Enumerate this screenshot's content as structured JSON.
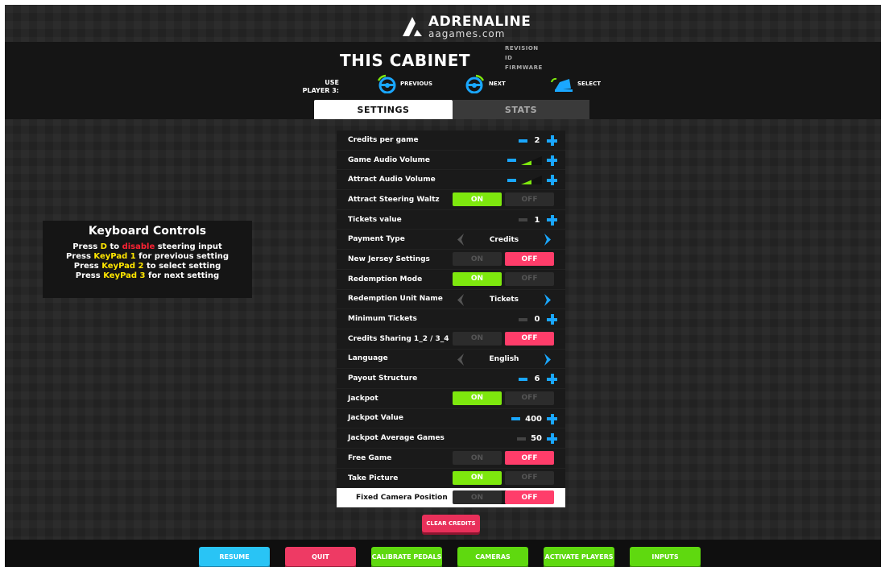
{
  "brand": {
    "name": "ADRENALINE",
    "site": "aagames.com"
  },
  "header": {
    "title": "THIS CABINET",
    "meta": [
      "REVISION",
      "ID",
      "FIRMWARE"
    ],
    "use_label_1": "USE",
    "use_label_2": "PLAYER 3:",
    "nav": [
      {
        "label": "PREVIOUS",
        "icon": "steering-wheel-left-icon"
      },
      {
        "label": "NEXT",
        "icon": "steering-wheel-right-icon"
      },
      {
        "label": "SELECT",
        "icon": "pedal-icon"
      }
    ]
  },
  "tabs": {
    "settings": "SETTINGS",
    "stats": "STATS",
    "active": "settings"
  },
  "keyboard": {
    "heading": "Keyboard Controls",
    "line1": {
      "a": "Press ",
      "b": "D",
      "c": " to ",
      "d": "disable",
      "e": " steering input"
    },
    "line2": {
      "a": "Press ",
      "b": "KeyPad 1",
      "c": " for previous setting"
    },
    "line3": {
      "a": "Press ",
      "b": "KeyPad 2",
      "c": " to select setting"
    },
    "line4": {
      "a": "Press ",
      "b": "KeyPad 3",
      "c": " for next setting"
    }
  },
  "toggle_labels": {
    "on": "ON",
    "off": "OFF"
  },
  "settings": [
    {
      "label": "Credits per game",
      "type": "number",
      "value": "2",
      "minus_enabled": true
    },
    {
      "label": "Game Audio Volume",
      "type": "volume",
      "level": 0.5
    },
    {
      "label": "Attract Audio Volume",
      "type": "volume",
      "level": 0.5
    },
    {
      "label": "Attract Steering Waltz",
      "type": "toggle",
      "state": "on"
    },
    {
      "label": "Tickets value",
      "type": "number",
      "value": "1",
      "minus_enabled": false
    },
    {
      "label": "Payment Type",
      "type": "select",
      "value": "Credits"
    },
    {
      "label": "New Jersey Settings",
      "type": "toggle",
      "state": "off"
    },
    {
      "label": "Redemption Mode",
      "type": "toggle",
      "state": "on"
    },
    {
      "label": "Redemption Unit Name",
      "type": "select",
      "value": "Tickets"
    },
    {
      "label": "Minimum Tickets",
      "type": "number",
      "value": "0",
      "minus_enabled": false
    },
    {
      "label": "Credits Sharing 1_2 / 3_4",
      "type": "toggle",
      "state": "off"
    },
    {
      "label": "Language",
      "type": "select",
      "value": "English"
    },
    {
      "label": "Payout Structure",
      "type": "number",
      "value": "6",
      "minus_enabled": true
    },
    {
      "label": "Jackpot",
      "type": "toggle",
      "state": "on"
    },
    {
      "label": "Jackpot Value",
      "type": "number",
      "value": "400",
      "minus_enabled": true
    },
    {
      "label": "Jackpot Average Games",
      "type": "number",
      "value": "50",
      "minus_enabled": false
    },
    {
      "label": "Free Game",
      "type": "toggle",
      "state": "off"
    },
    {
      "label": "Take Picture",
      "type": "toggle",
      "state": "on"
    },
    {
      "label": "Fixed Camera Position",
      "type": "toggle",
      "state": "off",
      "highlighted": true
    }
  ],
  "clear_credits": "CLEAR CREDITS",
  "bottom_buttons": [
    {
      "label": "RESUME",
      "color": "#29c4f5",
      "shadow": "#1780a8"
    },
    {
      "label": "QUIT",
      "color": "#ee3a64",
      "shadow": "#9c1a38"
    },
    {
      "label": "CALIBRATE PEDALS",
      "color": "#5fd90f",
      "shadow": "#3a8a08"
    },
    {
      "label": "CAMERAS",
      "color": "#5fd90f",
      "shadow": "#3a8a08"
    },
    {
      "label": "ACTIVATE PLAYERS",
      "color": "#5fd90f",
      "shadow": "#3a8a08"
    },
    {
      "label": "INPUTS",
      "color": "#5fd90f",
      "shadow": "#3a8a08"
    }
  ],
  "colors": {
    "accent_blue": "#1aa7ff",
    "on_green": "#7ee80e",
    "off_pink": "#ff3d6a"
  }
}
